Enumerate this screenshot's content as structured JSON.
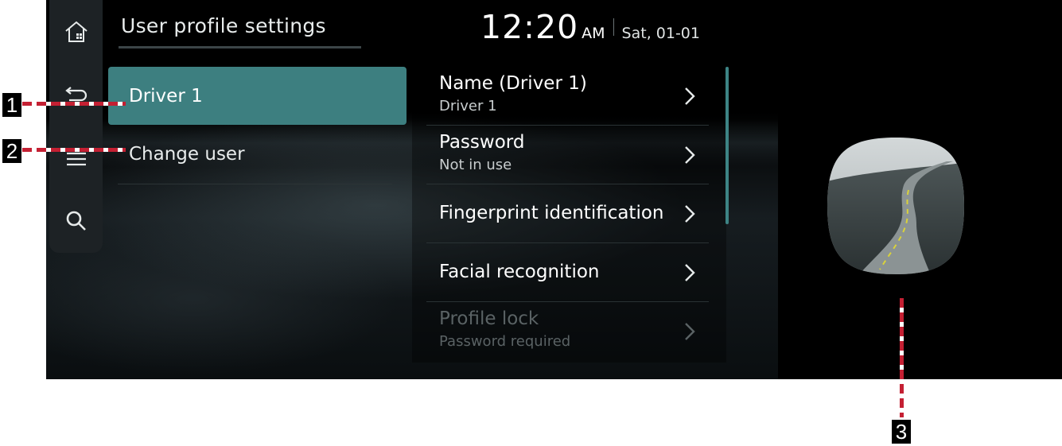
{
  "header": {
    "title": "User profile settings",
    "time": "12:20",
    "ampm": "AM",
    "date": "Sat, 01-01"
  },
  "nav": {
    "icons": [
      "home-icon",
      "back-icon",
      "menu-icon",
      "search-icon"
    ]
  },
  "menu": {
    "items": [
      {
        "label": "Driver 1",
        "selected": true
      },
      {
        "label": "Change user",
        "selected": false
      }
    ]
  },
  "settings": {
    "rows": [
      {
        "title": "Name (Driver 1)",
        "subtitle": "Driver 1",
        "enabled": true
      },
      {
        "title": "Password",
        "subtitle": "Not in use",
        "enabled": true
      },
      {
        "title": "Fingerprint identification",
        "enabled": true
      },
      {
        "title": "Facial recognition",
        "enabled": true
      },
      {
        "title": "Profile lock",
        "subtitle": "Password required",
        "enabled": false
      }
    ]
  },
  "callouts": {
    "one": "1",
    "two": "2",
    "three": "3",
    "color": "#c42033"
  },
  "colors": {
    "accent": "#3d7f80",
    "background": "#000000"
  }
}
